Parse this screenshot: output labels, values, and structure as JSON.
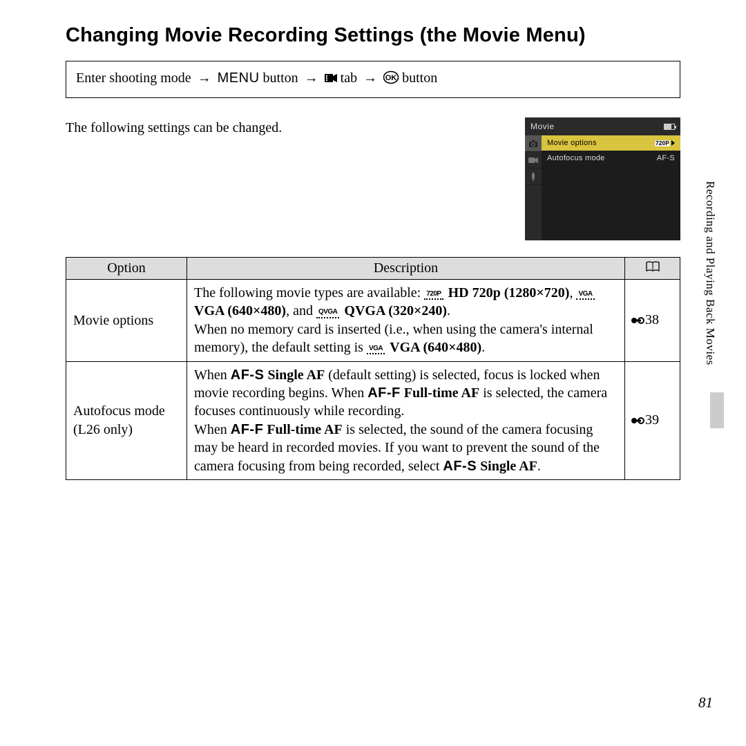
{
  "heading": "Changing Movie Recording Settings (the Movie Menu)",
  "nav": {
    "text1": "Enter shooting mode",
    "menu": "MENU",
    "text2": "button",
    "text3": "tab",
    "text4": "button"
  },
  "intro": "The following settings can be changed.",
  "lcd": {
    "title": "Movie",
    "rows": [
      {
        "label": "Movie options",
        "value": "720P",
        "highlighted": true
      },
      {
        "label": "Autofocus mode",
        "value": "AF-S",
        "highlighted": false
      }
    ]
  },
  "table": {
    "headers": {
      "opt": "Option",
      "desc": "Description",
      "ref_icon": "book"
    },
    "rows": [
      {
        "option": "Movie options",
        "desc_parts": {
          "p1": "The following movie types are available: ",
          "b1": "HD 720p (1280×720)",
          "sep1": ", ",
          "b2": "VGA (640×480)",
          "mid": ", and ",
          "b3": "QVGA (320×240)",
          "tail": ".",
          "p2a": "When no memory card is inserted (i.e., when using the camera's internal memory), the default setting is ",
          "b4": "VGA (640×480)",
          "p2b": "."
        },
        "ref": "38"
      },
      {
        "option": "Autofocus mode",
        "option_sub": "(L26 only)",
        "desc_parts": {
          "p1": "When ",
          "af1": "AF-S",
          "b1": "Single AF",
          "p2": " (default setting) is selected, focus is locked when movie recording begins. When ",
          "af2": "AF-F",
          "b2": "Full-time AF",
          "p3": " is selected, the camera focuses continuously while recording.",
          "p4": "When ",
          "af3": "AF-F",
          "b3": "Full-time AF",
          "p5": " is selected, the sound of the camera focusing may be heard in recorded movies. If you want to prevent the sound of the camera focusing from being recorded, select ",
          "af4": "AF-S",
          "b4": "Single AF",
          "p6": "."
        },
        "ref": "39"
      }
    ]
  },
  "side_label": "Recording and Playing Back Movies",
  "page_number": "81"
}
